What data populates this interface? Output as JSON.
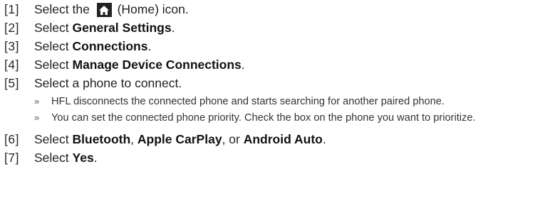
{
  "steps": [
    {
      "num": "[1]",
      "pre": "Select the",
      "post": "(Home) icon."
    },
    {
      "num": "[2]",
      "pre": "Select ",
      "bold": "General Settings",
      "post": "."
    },
    {
      "num": "[3]",
      "pre": "Select ",
      "bold": "Connections",
      "post": "."
    },
    {
      "num": "[4]",
      "pre": "Select ",
      "bold": "Manage Device Connections",
      "post": "."
    },
    {
      "num": "[5]",
      "text": "Select a phone to connect."
    },
    {
      "num": "[6]",
      "pre": "Select ",
      "bold1": "Bluetooth",
      "mid1": ", ",
      "bold2": "Apple CarPlay",
      "mid2": ", or ",
      "bold3": "Android Auto",
      "post": "."
    },
    {
      "num": "[7]",
      "pre": "Select ",
      "bold": "Yes",
      "post": "."
    }
  ],
  "step5_notes": [
    {
      "marker": "»",
      "text": "HFL disconnects the connected phone and starts searching for another paired phone."
    },
    {
      "marker": "»",
      "text": "You can set the connected phone priority. Check the box on the phone you want to prioritize."
    }
  ],
  "icons": {
    "home": "home-icon",
    "home_icon_bg": "#222222",
    "home_icon_fg": "#ffffff"
  }
}
